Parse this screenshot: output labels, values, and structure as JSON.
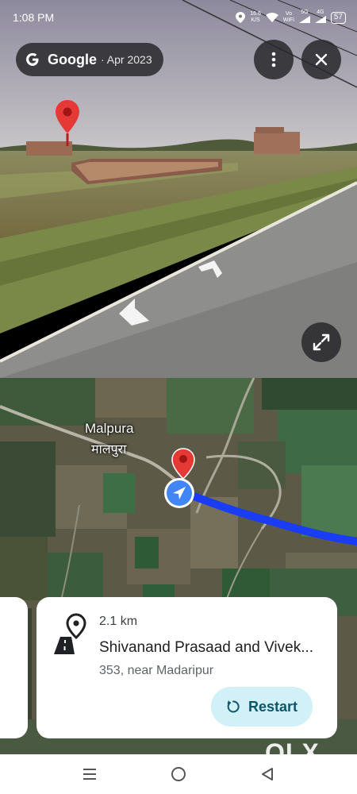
{
  "status_bar": {
    "time": "1:08 PM",
    "speed_value": "16.6",
    "speed_unit": "K/S",
    "vowifi_top": "Vo",
    "vowifi_bottom": "WiFi",
    "signal_label": "5G",
    "signal2_label": "4G",
    "battery": "57"
  },
  "street_view": {
    "brand": "Google",
    "date": "· Apr 2023"
  },
  "map": {
    "place_name_en": "Malpura",
    "place_name_hi": "मालपुरा"
  },
  "route_card": {
    "distance": "2.1 km",
    "title": "Shivanand Prasaad and Vivek...",
    "address": "353, near Madaripur",
    "restart_label": "Restart"
  },
  "watermark": "OLX",
  "colors": {
    "route_blue": "#1a3cf2",
    "pin_red": "#e53935",
    "restart_bg": "#d2f0f7",
    "location_blue": "#4285f4"
  },
  "icons": [
    "google-g-icon",
    "more-vert-icon",
    "close-icon",
    "expand-icon",
    "location-pin-icon",
    "navigation-arrow-icon",
    "route-pin-icon",
    "restart-icon",
    "recents-icon",
    "home-icon",
    "back-icon"
  ]
}
